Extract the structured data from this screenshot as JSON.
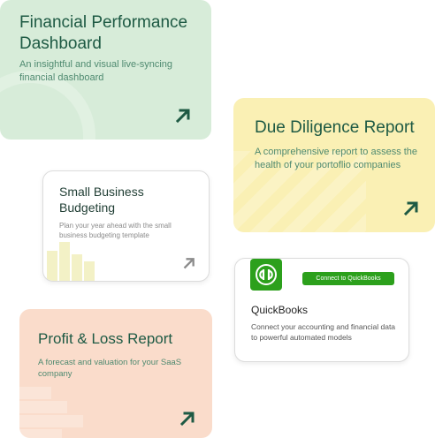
{
  "cards": {
    "financial": {
      "title": "Financial Performance Dashboard",
      "description": "An insightful and visual live-syncing financial dashboard",
      "color": "#d7ecd9"
    },
    "due_diligence": {
      "title": "Due Diligence Report",
      "description": "A comprehensive report to assess the health of your portoflio companies",
      "color": "#faf0b4"
    },
    "small_business": {
      "title": "Small Business Budgeting",
      "description": "Plan your year ahead with the small business budgeting template"
    },
    "quickbooks": {
      "title": "QuickBooks",
      "connect_label": "Connect to QuickBooks",
      "description": "Connect your accounting and financial data to powerful automated models",
      "brand_color": "#2ca01c"
    },
    "profit_loss": {
      "title": "Profit & Loss Report",
      "description": "A forecast and valuation for your SaaS company",
      "color": "#fadccb"
    }
  },
  "icons": {
    "arrow": "arrow-up-right-icon",
    "quickbooks_logo": "quickbooks-logo-icon"
  }
}
